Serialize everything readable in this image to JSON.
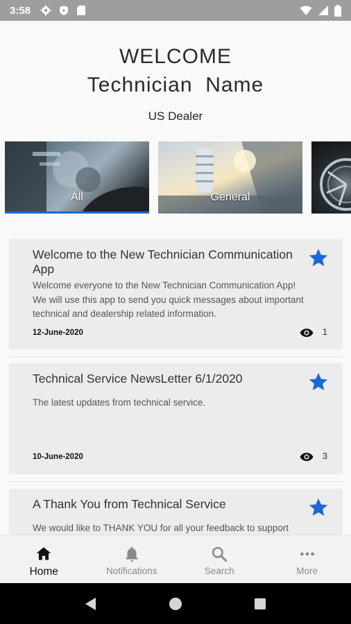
{
  "status_bar": {
    "time": "3:58",
    "left_icons": [
      "settings-icon",
      "play-protect-icon",
      "sd-card-icon"
    ],
    "right_icons": [
      "wifi-icon",
      "signal-icon",
      "battery-icon"
    ]
  },
  "header": {
    "welcome": "WELCOME",
    "technician_name": "Technician  Name",
    "dealer": "US Dealer"
  },
  "categories": [
    {
      "label": "All",
      "selected": true
    },
    {
      "label": "General",
      "selected": false
    },
    {
      "label": "",
      "selected": false
    }
  ],
  "messages": [
    {
      "title": "Welcome to the New Technician Communication App",
      "body": "Welcome everyone to the New Technician Communication App! We will use this app to send you quick messages about important technical and dealership related information.",
      "date": "12-June-2020",
      "views": "1",
      "starred": true
    },
    {
      "title": "Technical Service NewsLetter 6/1/2020",
      "body": "The latest updates from technical service.",
      "date": "10-June-2020",
      "views": "3",
      "starred": true
    },
    {
      "title": "A Thank You from Technical Service",
      "body": "We would like to THANK YOU for all your feedback to support",
      "starred": true
    }
  ],
  "bottom_nav": [
    {
      "label": "Home",
      "icon": "home-icon",
      "active": true
    },
    {
      "label": "Notifications",
      "icon": "bell-icon",
      "active": false
    },
    {
      "label": "Search",
      "icon": "search-icon",
      "active": false
    },
    {
      "label": "More",
      "icon": "more-icon",
      "active": false
    }
  ],
  "colors": {
    "accent": "#1c69d4",
    "status_bar": "#9e9e9e",
    "card_bg": "#ececec"
  }
}
